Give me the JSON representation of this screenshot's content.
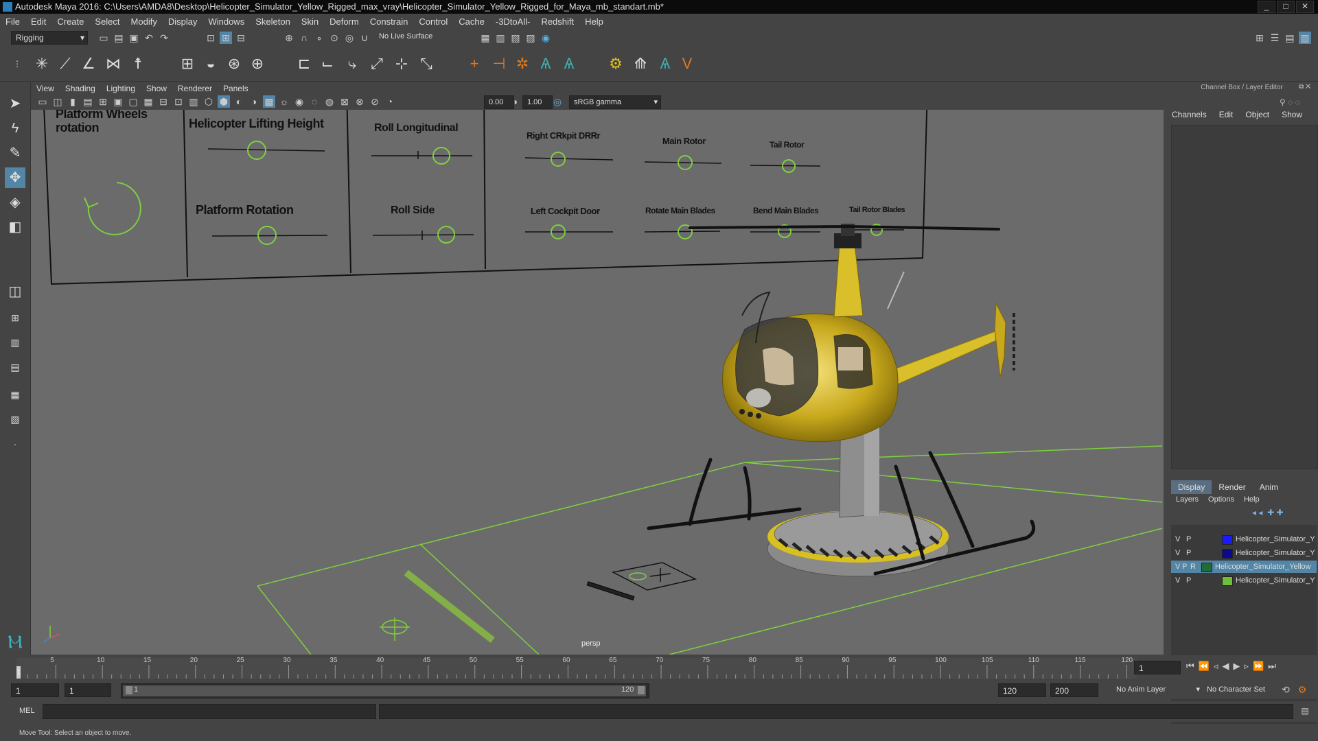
{
  "window": {
    "title": "Autodesk Maya 2016: C:\\Users\\AMDA8\\Desktop\\Helicopter_Simulator_Yellow_Rigged_max_vray\\Helicopter_Simulator_Yellow_Rigged_for_Maya_mb_standart.mb*",
    "buttons": [
      "_",
      "□",
      "✕"
    ]
  },
  "menubar": [
    "File",
    "Edit",
    "Create",
    "Select",
    "Modify",
    "Display",
    "Windows",
    "Skeleton",
    "Skin",
    "Deform",
    "Constrain",
    "Control",
    "Cache",
    "-3DtoAll-",
    "Redshift",
    "Help"
  ],
  "statusline": {
    "mode": "Rigging",
    "live_surface": "No Live Surface"
  },
  "viewport": {
    "menus": [
      "View",
      "Shading",
      "Lighting",
      "Show",
      "Renderer",
      "Panels"
    ],
    "exposure": "0.00",
    "gamma": "1.00",
    "color_space": "sRGB gamma",
    "camera_label": "persp",
    "control_board": {
      "labels": {
        "platform_wheels": "Platform Wheels rotation",
        "lifting_height": "Helicopter Lifting Height",
        "platform_rotation": "Platform Rotation",
        "roll_longitudinal": "Roll Longitudinal",
        "roll_side": "Roll Side",
        "right_door": "Right CRkpit DRRr",
        "main_rotor": "Main Rotor",
        "tail_rotor": "Tail Rotor",
        "left_door": "Left Cockpit Door",
        "rotate_main_blades": "Rotate Main Blades",
        "bend_main_blades": "Bend Main Blades",
        "tail_rotor_blades": "Tail Rotor Blades"
      }
    }
  },
  "channel_box": {
    "title": "Channel Box / Layer Editor",
    "menus": [
      "Channels",
      "Edit",
      "Object",
      "Show"
    ],
    "layer_tabs": [
      "Display",
      "Render",
      "Anim"
    ],
    "active_tab": "Display",
    "layer_menus": [
      "Layers",
      "Options",
      "Help"
    ],
    "layers": [
      {
        "v": "V",
        "p": "P",
        "r": "",
        "color": "#1a1aff",
        "name": "Helicopter_Simulator_Y",
        "selected": false
      },
      {
        "v": "V",
        "p": "P",
        "r": "",
        "color": "#0a0a8a",
        "name": "Helicopter_Simulator_Y",
        "selected": false
      },
      {
        "v": "V",
        "p": "P",
        "r": "R",
        "color": "#1f6b3a",
        "name": "Helicopter_Simulator_Yellow",
        "selected": true
      },
      {
        "v": "V",
        "p": "P",
        "r": "",
        "color": "#6fbf3a",
        "name": "Helicopter_Simulator_Y",
        "selected": false
      }
    ]
  },
  "timeline": {
    "ticks": [
      "5",
      "10",
      "15",
      "20",
      "25",
      "30",
      "35",
      "40",
      "45",
      "50",
      "55",
      "60",
      "65",
      "70",
      "75",
      "80",
      "85",
      "90",
      "95",
      "100",
      "105",
      "110",
      "115",
      "120"
    ],
    "current_frame": "1",
    "start_marker": "1"
  },
  "range": {
    "start": "1",
    "playback_start": "1",
    "slider_start": "1",
    "slider_end": "120",
    "playback_end": "120",
    "end": "200",
    "anim_layer": "No Anim Layer",
    "character_set": "No Character Set"
  },
  "command_line": {
    "label": "MEL"
  },
  "help_line": "Move Tool: Select an object to move."
}
